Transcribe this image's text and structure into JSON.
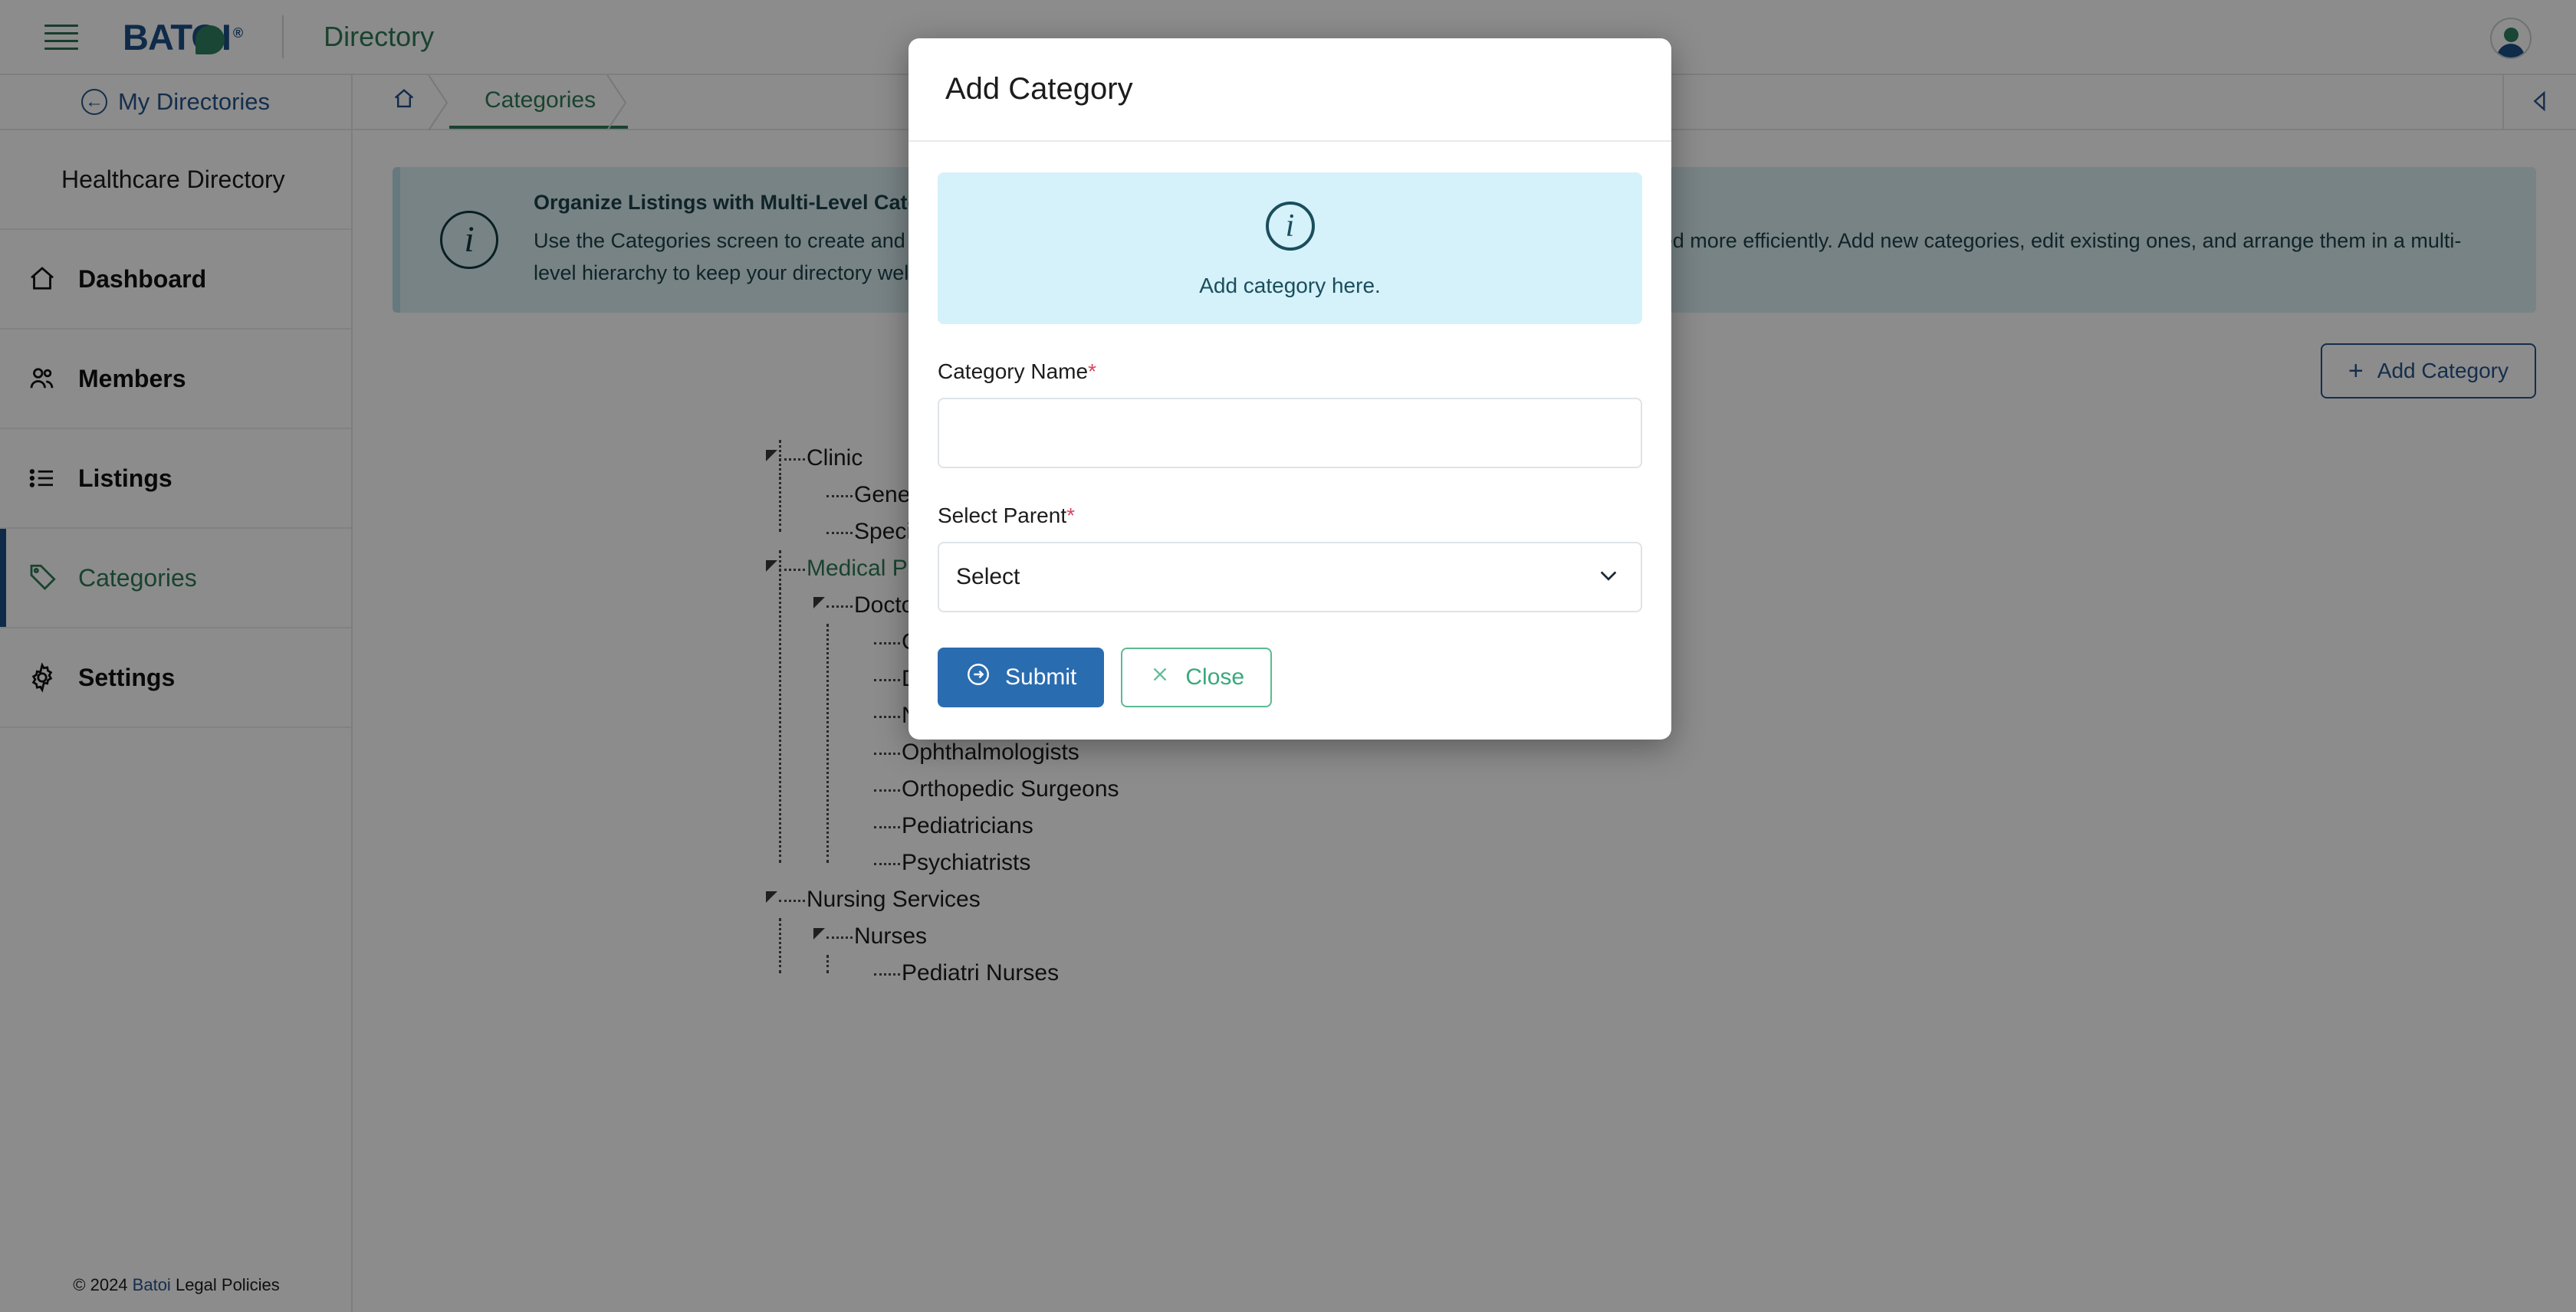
{
  "header": {
    "menu_icon": "hamburger-icon",
    "logo_text": "BATO",
    "logo_trademark": "®",
    "app_name": "Directory",
    "avatar_icon": "user-avatar-icon"
  },
  "sidebar": {
    "back_label": "My Directories",
    "back_icon": "circle-arrow-left-icon",
    "directory_name": "Healthcare Directory",
    "items": [
      {
        "label": "Dashboard",
        "icon": "home-icon",
        "active": false
      },
      {
        "label": "Members",
        "icon": "users-icon",
        "active": false
      },
      {
        "label": "Listings",
        "icon": "list-icon",
        "active": false
      },
      {
        "label": "Categories",
        "icon": "tag-icon",
        "active": true
      },
      {
        "label": "Settings",
        "icon": "gear-icon",
        "active": false
      }
    ]
  },
  "footer": {
    "copyright": "© 2024",
    "brand": "Batoi",
    "legal": "Legal Policies"
  },
  "breadcrumb": {
    "home_icon": "home-icon",
    "items": [
      "Categories"
    ],
    "collapse_icon": "triangle-left-icon"
  },
  "banner": {
    "icon": "info-circle-icon",
    "title": "Organize Listings with Multi-Level Categories",
    "body": "Use the Categories screen to create and manage a structured category system, helping visitors find the information they need more efficiently. Add new categories, edit existing ones, and arrange them in a multi-level hierarchy to keep your directory well-organized."
  },
  "toolbar": {
    "add_category_label": "Add Category",
    "add_icon": "plus-icon"
  },
  "tree": [
    {
      "label": "Clinic",
      "highlight": false,
      "children": [
        {
          "label": "General Clinics",
          "highlight": false,
          "children": []
        },
        {
          "label": "Specialty Clinics",
          "highlight": false,
          "children": []
        }
      ]
    },
    {
      "label": "Medical Practitioners",
      "highlight": true,
      "children": [
        {
          "label": "Doctors",
          "highlight": false,
          "children": [
            {
              "label": "Cardiologists",
              "highlight": false,
              "children": []
            },
            {
              "label": "Dermatologists",
              "highlight": false,
              "children": []
            },
            {
              "label": "Neurologists",
              "highlight": false,
              "children": []
            },
            {
              "label": "Ophthalmologists",
              "highlight": false,
              "children": []
            },
            {
              "label": "Orthopedic Surgeons",
              "highlight": false,
              "children": []
            },
            {
              "label": "Pediatricians",
              "highlight": false,
              "children": []
            },
            {
              "label": "Psychiatrists",
              "highlight": false,
              "children": []
            }
          ]
        }
      ]
    },
    {
      "label": "Nursing Services",
      "highlight": false,
      "children": [
        {
          "label": "Nurses",
          "highlight": false,
          "children": [
            {
              "label": "Pediatri Nurses",
              "highlight": false,
              "children": []
            }
          ]
        }
      ]
    }
  ],
  "modal": {
    "title": "Add Category",
    "info_icon": "info-circle-icon",
    "info_text": "Add category here.",
    "category_name_label": "Category Name",
    "category_name_required": "*",
    "category_name_value": "",
    "category_name_placeholder": "",
    "select_parent_label": "Select Parent",
    "select_parent_required": "*",
    "select_parent_value": "Select",
    "select_chevron_icon": "chevron-down-icon",
    "submit_label": "Submit",
    "submit_icon": "arrow-circle-right-icon",
    "close_label": "Close",
    "close_icon": "x-icon"
  },
  "colors": {
    "brand_blue": "#1d4f86",
    "brand_green": "#2f7a56",
    "submit_blue": "#2a6cb0",
    "close_green": "#3aa87d",
    "required_red": "#d9455f",
    "banner_cyan": "#d5f1fa"
  }
}
